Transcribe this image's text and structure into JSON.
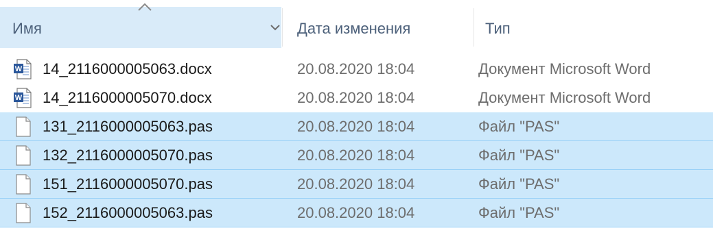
{
  "header": {
    "name_label": "Имя",
    "date_label": "Дата изменения",
    "type_label": "Тип"
  },
  "files": [
    {
      "name": "14_2116000005063.docx",
      "date": "20.08.2020 18:04",
      "type": "Документ Microsoft Word",
      "icon": "word-document-icon",
      "selected": false
    },
    {
      "name": "14_2116000005070.docx",
      "date": "20.08.2020 18:04",
      "type": "Документ Microsoft Word",
      "icon": "word-document-icon",
      "selected": false
    },
    {
      "name": "131_2116000005063.pas",
      "date": "20.08.2020 18:04",
      "type": "Файл \"PAS\"",
      "icon": "blank-file-icon",
      "selected": true
    },
    {
      "name": "132_2116000005070.pas",
      "date": "20.08.2020 18:04",
      "type": "Файл \"PAS\"",
      "icon": "blank-file-icon",
      "selected": true
    },
    {
      "name": "151_2116000005070.pas",
      "date": "20.08.2020 18:04",
      "type": "Файл \"PAS\"",
      "icon": "blank-file-icon",
      "selected": true
    },
    {
      "name": "152_2116000005063.pas",
      "date": "20.08.2020 18:04",
      "type": "Файл \"PAS\"",
      "icon": "blank-file-icon",
      "selected": true
    }
  ],
  "colors": {
    "selection": "#cce8fb",
    "header_text": "#4c607a",
    "active_column": "#d9ebf9"
  }
}
